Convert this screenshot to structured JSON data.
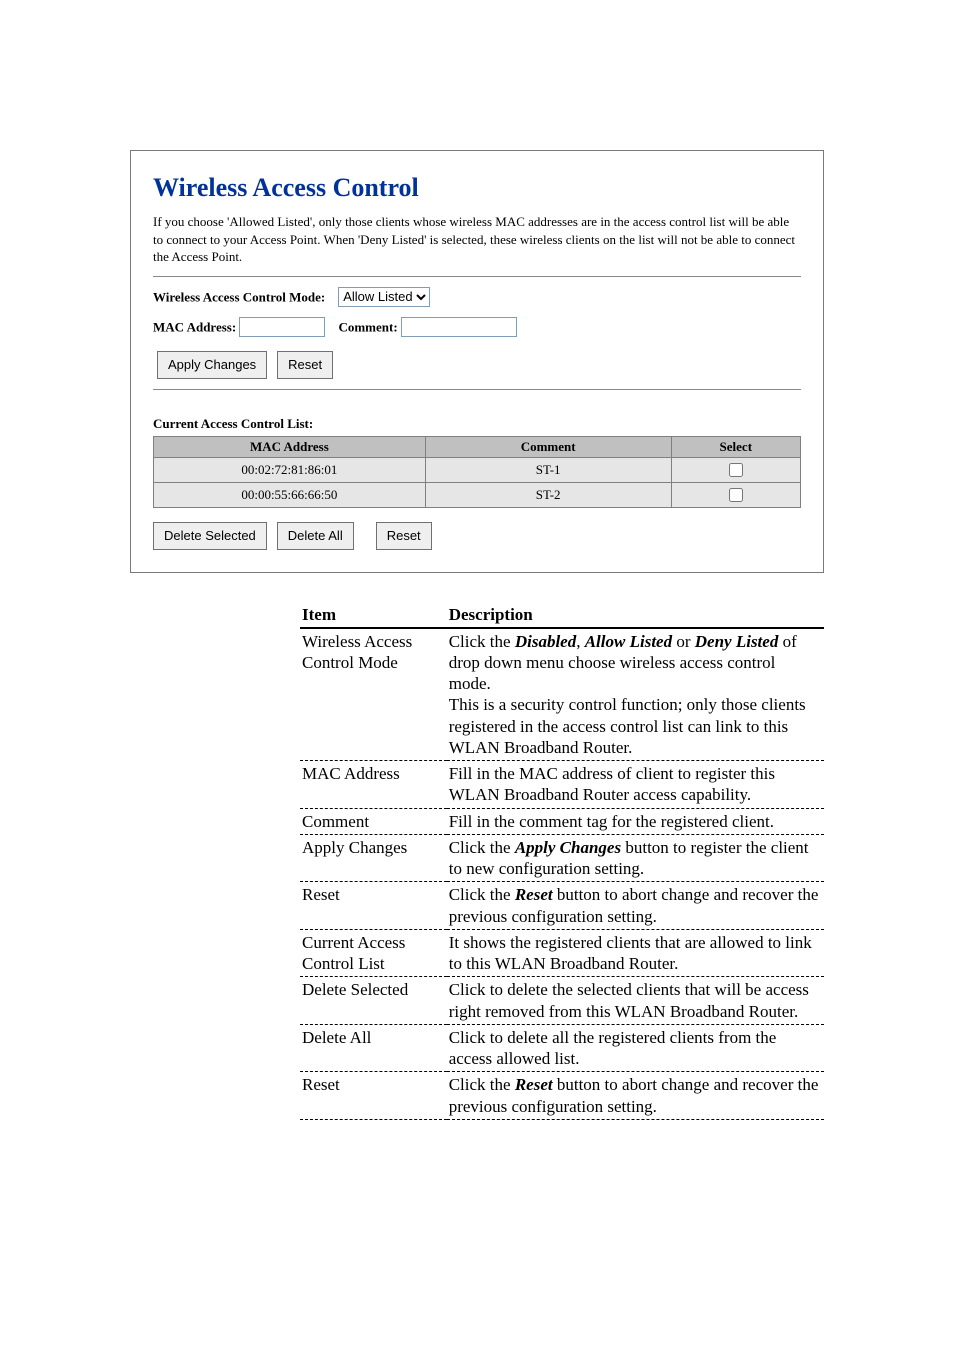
{
  "panel": {
    "title": "Wireless Access Control",
    "intro": "If you choose 'Allowed Listed', only those clients whose wireless MAC addresses are in the access control list will be able to connect to your Access Point. When 'Deny Listed' is selected, these wireless clients on the list will not be able to connect the Access Point.",
    "modeLabel": "Wireless Access Control Mode:",
    "modeValue": "Allow Listed",
    "macLabel": "MAC Address:",
    "macValue": "",
    "commentLabel": "Comment:",
    "commentValue": "",
    "applyBtn": "Apply Changes",
    "resetBtn": "Reset",
    "listTitle": "Current Access Control List:",
    "headers": {
      "mac": "MAC Address",
      "comment": "Comment",
      "select": "Select"
    },
    "rows": [
      {
        "mac": "00:02:72:81:86:01",
        "comment": "ST-1"
      },
      {
        "mac": "00:00:55:66:66:50",
        "comment": "ST-2"
      }
    ],
    "deleteSelected": "Delete Selected",
    "deleteAll": "Delete All",
    "reset2": "Reset"
  },
  "doc": {
    "headItem": "Item",
    "headDesc": "Description",
    "rows": [
      {
        "item": "Wireless Access Control Mode",
        "desc_pre": "Click the ",
        "b1": "Disabled",
        "mid1": ", ",
        "b2": "Allow Listed",
        "mid2": " or ",
        "b3": "Deny Listed",
        "desc_post": " of drop down menu choose wireless access control mode.",
        "extra": "This is a security control function; only those clients registered in the access control list can link to this WLAN Broadband Router."
      },
      {
        "item": "MAC Address",
        "plain": "Fill in the MAC address of client to register this WLAN Broadband Router access capability."
      },
      {
        "item": "Comment",
        "plain": "Fill in the comment tag for the registered client."
      },
      {
        "item": "Apply Changes",
        "desc_pre": "Click the ",
        "b1": "Apply Changes",
        "desc_post": " button to register the client to new configuration setting."
      },
      {
        "item": "Reset",
        "desc_pre": "Click the ",
        "b1": "Reset",
        "desc_post": " button to abort change and recover the previous configuration setting."
      },
      {
        "item": "Current Access Control List",
        "plain": "It shows the registered clients that are allowed to link to this WLAN Broadband Router."
      },
      {
        "item": "Delete Selected",
        "plain": "Click to delete the selected clients that will be access right removed from this WLAN Broadband Router."
      },
      {
        "item": "Delete All",
        "plain": "Click to delete all the registered clients from the access allowed list."
      },
      {
        "item": "Reset",
        "desc_pre": "Click the ",
        "b1": "Reset",
        "desc_post": " button to abort change and recover the previous configuration setting."
      }
    ]
  }
}
